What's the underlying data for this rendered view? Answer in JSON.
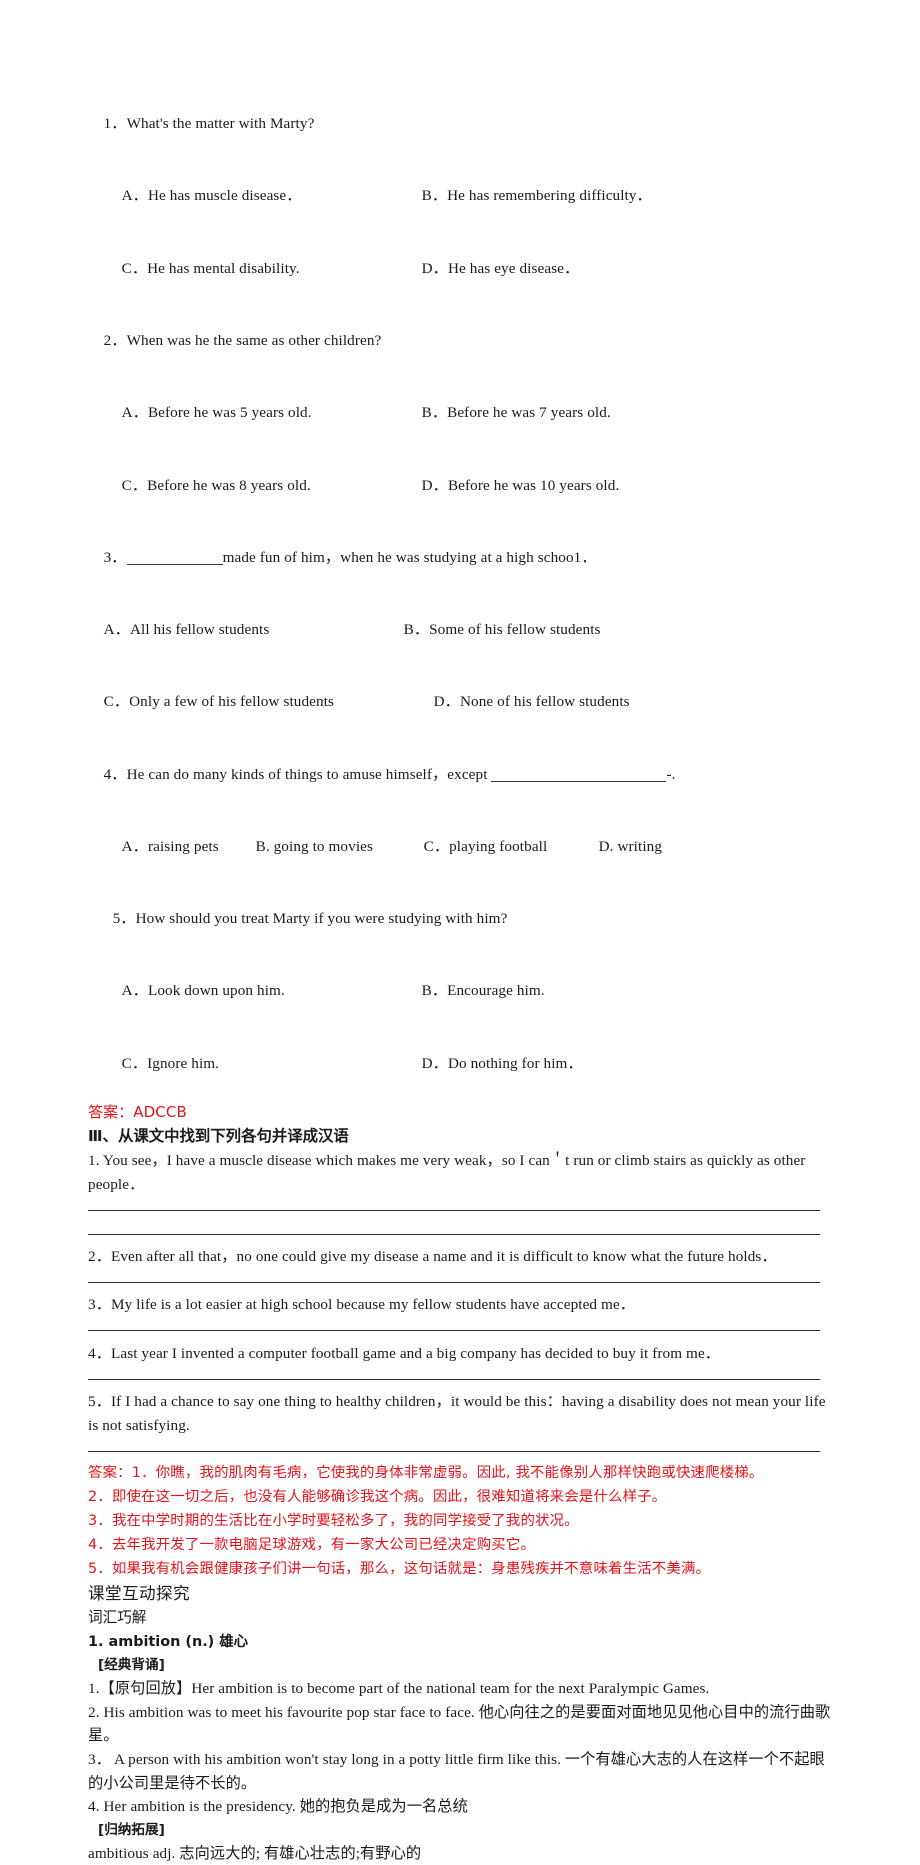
{
  "reading_questions": [
    {
      "number": "1．",
      "stem": "What's the matter with Marty?",
      "options_row1_left": "A．He has muscle disease．",
      "options_row1_right": "B．He has remembering difficulty．",
      "options_row2_left": "C．He has mental disability.",
      "options_row2_right": "D．He has eye disease．"
    },
    {
      "number": "2．",
      "stem": "When was he the same as other children?",
      "options_row1_left": "A．Before he was 5 years old.",
      "options_row1_right": "B．Before he was 7 years old.",
      "options_row2_left": "C．Before he was 8 years old.",
      "options_row2_right": "D．Before he was 10 years old."
    },
    {
      "number": "3．",
      "stem_before_blank": "3．",
      "stem_after_blank": "made fun of him，when he was studying at a high schoo1．",
      "options_row1_left": "A．All his fellow students",
      "options_row1_right": "B．Some of his fellow students",
      "options_row2_left": "C．Only a few of his fellow students",
      "options_row2_right": "D．None of his fellow students"
    },
    {
      "number": "4．",
      "stem_before_blank": "4．He can do many kinds of things to amuse himself，except ",
      "stem_after_blank": "-.",
      "opt_a": "A．raising pets",
      "opt_b": "B. going to movies",
      "opt_c": "C．playing football",
      "opt_d": "D. writing"
    },
    {
      "number": "5．",
      "stem": "How should you treat Marty if you were studying with him?",
      "options_row1_left": "A．Look down upon him.",
      "options_row1_right": "B．Encourage him.",
      "options_row2_left": "C．Ignore him.",
      "options_row2_right": "D．Do nothing for him．"
    }
  ],
  "answer_mc": "答案：ADCCB",
  "section_three": {
    "heading": "Ⅲ、从课文中找到下列各句并译成汉语",
    "sentences": [
      "1. You see，I have a muscle disease which makes me very weak，so I can＇t run or climb stairs as quickly as other people．",
      "2．Even after all that，no one could give my disease a name and it is difficult to know what the future holds．",
      "3．My life is a lot easier at high school because my fellow students have accepted me．",
      "4．Last year I invented a computer football game and a big company has decided to buy it from me．",
      "5．If I had a chance to say one thing to healthy children，it would be this：having a disability does not mean your life is not satisfying."
    ],
    "answers": [
      "答案：1．你瞧，我的肌肉有毛病，它使我的身体非常虚弱。因此, 我不能像别人那样快跑或快速爬楼梯。",
      "2．即使在这一切之后，也没有人能够确诊我这个病。因此，很难知道将来会是什么样子。",
      "3．我在中学时期的生活比在小学时要轻松多了，我的同学接受了我的状况。",
      "4．去年我开发了一款电脑足球游戏，有一家大公司已经决定购买它。",
      "5．如果我有机会跟健康孩子们讲一句话，那么，这句话就是：身患残疾并不意味着生活不美满。"
    ]
  },
  "classroom": {
    "heading": "课堂互动探究",
    "subheading": "词汇巧解",
    "entry_title": "1. ambition     (n.) 雄心",
    "recite_label": "[经典背诵]",
    "examples": [
      "1.【原句回放】Her ambition is to become part of the national team for the next Paralympic Games.",
      "2. His ambition was to meet his favourite pop star face to face. 他心向往之的是要面对面地见见他心目中的流行曲歌星。",
      "3．  A person with his ambition won't stay long in a potty little firm like this. 一个有雄心大志的人在这样一个不起眼的小公司里是待不长的。",
      "4. Her ambition is the presidency. 她的抱负是成为一名总统"
    ],
    "extend_label": "[归纳拓展]",
    "extend_text": "ambitious adj. 志向远大的; 有雄心壮志的;有野心的"
  },
  "colors": {
    "answer_red": "#e3131a",
    "text": "#1a1a1a",
    "rule": "#2b2b2b"
  }
}
